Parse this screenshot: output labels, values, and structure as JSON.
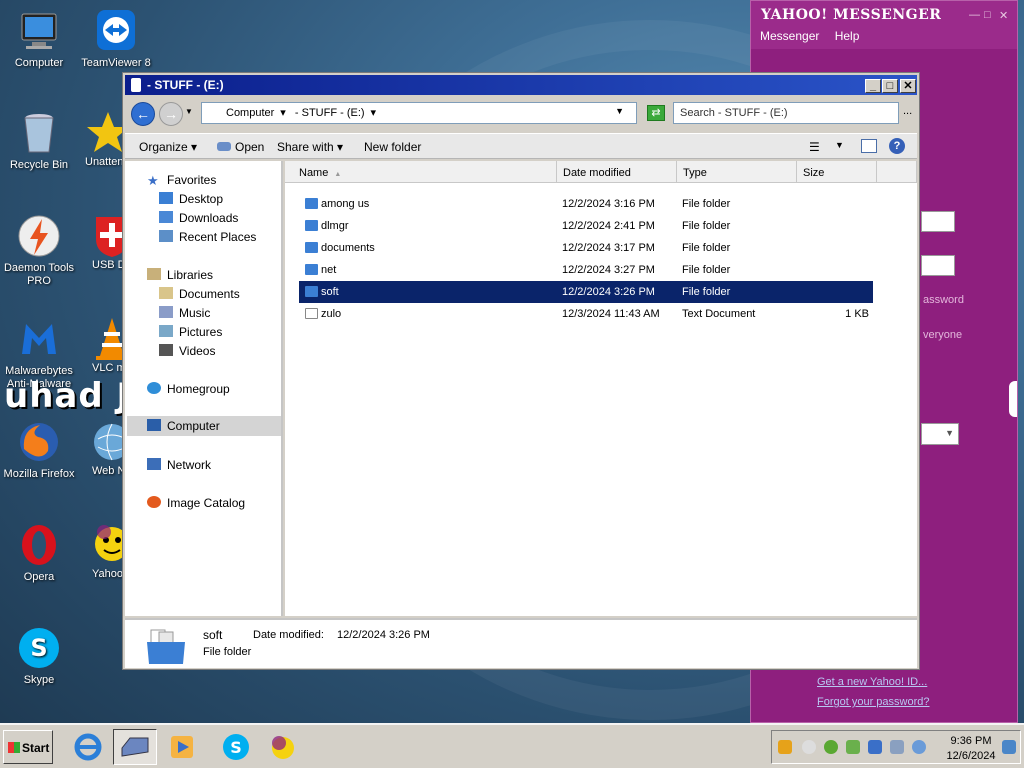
{
  "desktop": {
    "icons": [
      {
        "label": "Computer"
      },
      {
        "label": "TeamViewer 8"
      },
      {
        "label": "Recycle Bin"
      },
      {
        "label": "Unattended Soft"
      },
      {
        "label": "Daemon Tools PRO"
      },
      {
        "label": "USB Disk Security"
      },
      {
        "label": "Malwarebytes Anti-Malware"
      },
      {
        "label": "VLC media player"
      },
      {
        "label": "Mozilla Firefox"
      },
      {
        "label": "Web Navigator"
      },
      {
        "label": "Opera"
      },
      {
        "label": "Yahoo! Messenger"
      },
      {
        "label": "Skype"
      }
    ],
    "watermark": "uhad J"
  },
  "yahoo": {
    "title": "YAHOO! MESSENGER",
    "menu": [
      "Messenger",
      "Help"
    ],
    "text_password": "assword",
    "text_everyone": "veryone",
    "link_new_id": "Get a new Yahoo! ID...",
    "link_forgot": "Forgot your password?"
  },
  "explorer": {
    "title": "- STUFF - (E:)",
    "address": [
      "Computer",
      "- STUFF - (E:)"
    ],
    "search_placeholder": "Search - STUFF - (E:)",
    "commands": {
      "organize": "Organize",
      "open": "Open",
      "share": "Share with",
      "new_folder": "New folder"
    },
    "nav": {
      "favorites": "Favorites",
      "desktop": "Desktop",
      "downloads": "Downloads",
      "recent": "Recent Places",
      "libraries": "Libraries",
      "documents": "Documents",
      "music": "Music",
      "pictures": "Pictures",
      "videos": "Videos",
      "homegroup": "Homegroup",
      "computer": "Computer",
      "network": "Network",
      "image_catalog": "Image Catalog"
    },
    "columns": {
      "name": "Name",
      "date": "Date modified",
      "type": "Type",
      "size": "Size"
    },
    "files": [
      {
        "name": "among us",
        "date": "12/2/2024 3:16 PM",
        "type": "File folder",
        "size": ""
      },
      {
        "name": "dlmgr",
        "date": "12/2/2024 2:41 PM",
        "type": "File folder",
        "size": ""
      },
      {
        "name": "documents",
        "date": "12/2/2024 3:17 PM",
        "type": "File folder",
        "size": ""
      },
      {
        "name": "net",
        "date": "12/2/2024 3:27 PM",
        "type": "File folder",
        "size": ""
      },
      {
        "name": "soft",
        "date": "12/2/2024 3:26 PM",
        "type": "File folder",
        "size": ""
      },
      {
        "name": "zulo",
        "date": "12/3/2024 11:43 AM",
        "type": "Text Document",
        "size": "1 KB"
      }
    ],
    "selected_index": 4,
    "details": {
      "name": "soft",
      "date_label": "Date modified:",
      "date": "12/2/2024 3:26 PM",
      "type": "File folder"
    }
  },
  "taskbar": {
    "start": "Start",
    "time": "9:36 PM",
    "date": "12/6/2024"
  },
  "colors": {
    "selection": "#0a246a",
    "titlebar": "#0b1e8c",
    "yahoo": "#8e1f7e",
    "folder": "#3b7fd4"
  }
}
